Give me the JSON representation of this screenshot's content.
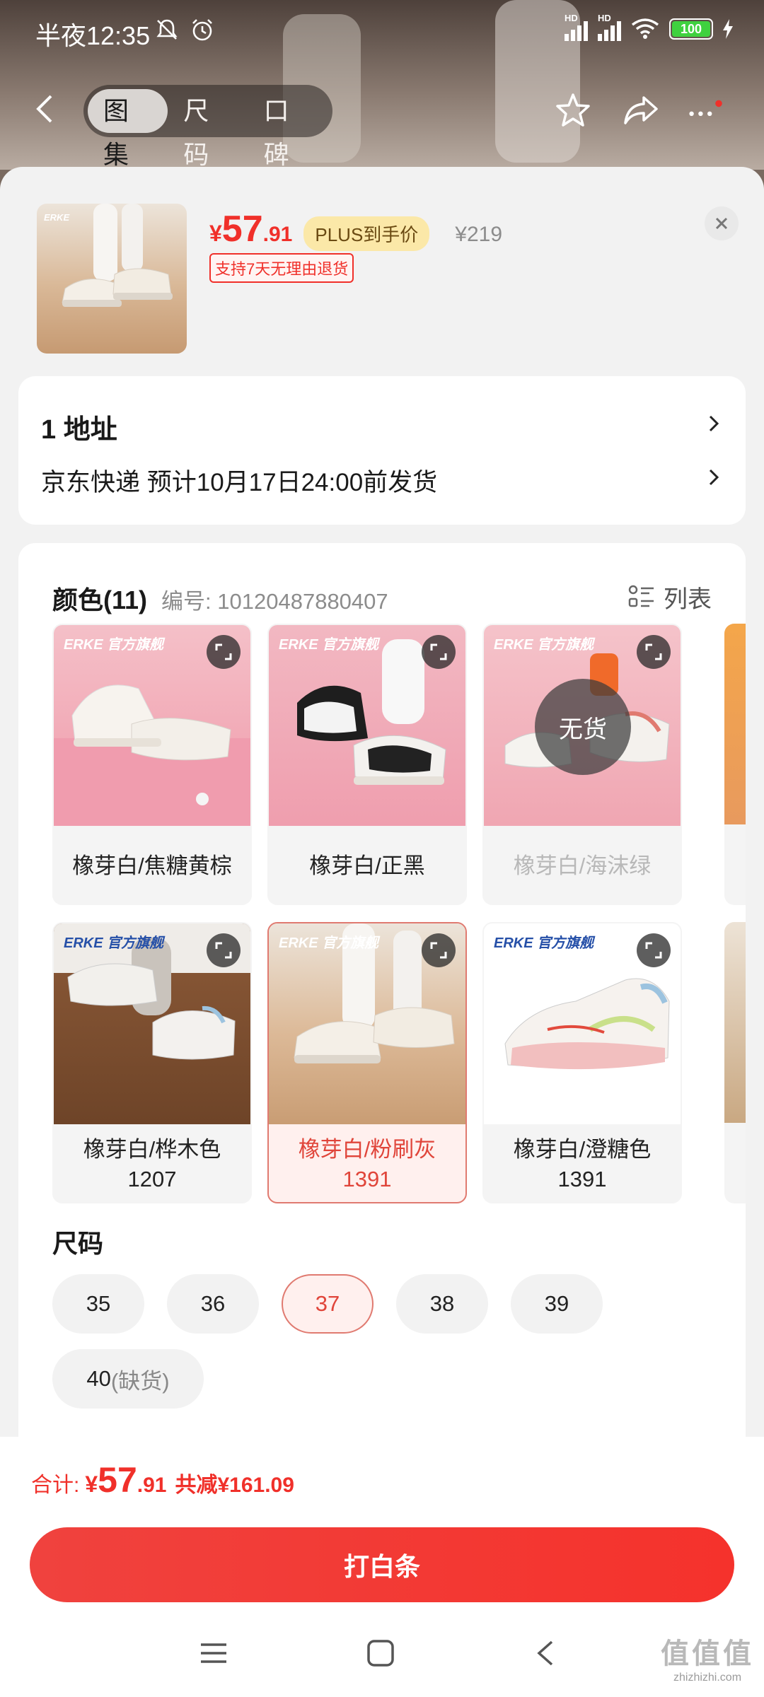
{
  "status_bar": {
    "time": "半夜12:35",
    "battery": "100",
    "signal_label": "HD",
    "icons": [
      "mute-bell-icon",
      "alarm-icon",
      "signal-icon",
      "signal-icon",
      "wifi-icon",
      "battery-icon",
      "charging-icon"
    ]
  },
  "nav": {
    "tabs": [
      {
        "label": "图集",
        "active": true
      },
      {
        "label": "尺码",
        "active": false
      },
      {
        "label": "口碑",
        "active": false
      }
    ],
    "icons": [
      "back-icon",
      "star-icon",
      "share-icon",
      "more-icon"
    ]
  },
  "product": {
    "currency": "¥",
    "price_int": "57",
    "price_dec": ".91",
    "plus_badge": "PLUS到手价",
    "original_price": "¥219",
    "return_policy": "支持7天无理由退货"
  },
  "address": {
    "line1": "1  地址",
    "line2": "京东快递 预计10月17日24:00前发货"
  },
  "spec": {
    "color_title": "颜色(11)",
    "code": "编号: 10120487880407",
    "list_label": "列表",
    "no_stock_label": "无货",
    "brand_logo": "ERKE 官方旗舰",
    "colors": [
      {
        "label": "橡芽白/焦糖黄棕",
        "state": "normal"
      },
      {
        "label": "橡芽白/正黑",
        "state": "normal"
      },
      {
        "label": "橡芽白/海沫绿",
        "state": "disabled"
      },
      {
        "label": "橡芽白/桦木色1207",
        "state": "normal"
      },
      {
        "label": "橡芽白/粉刷灰1391",
        "state": "selected"
      },
      {
        "label": "橡芽白/澄糖色1391",
        "state": "normal"
      }
    ],
    "size_title": "尺码",
    "sizes": [
      {
        "label": "35",
        "state": "normal"
      },
      {
        "label": "36",
        "state": "normal"
      },
      {
        "label": "37",
        "state": "selected"
      },
      {
        "label": "38",
        "state": "normal"
      },
      {
        "label": "39",
        "state": "normal"
      },
      {
        "label": "40",
        "note": "(缺货)",
        "state": "oos"
      }
    ]
  },
  "footer": {
    "total_label": "合计:",
    "currency": "¥",
    "total_int": "57",
    "total_dec": ".91",
    "saved": "共减¥161.09",
    "buy_button": "打白条"
  },
  "watermark": {
    "main": "值值值",
    "sub": "zhizhizhi.com"
  },
  "colors": {
    "accent": "#f0302a",
    "plus_bg": "#fbe8a8",
    "sheet_bg": "#f2f2f2"
  }
}
